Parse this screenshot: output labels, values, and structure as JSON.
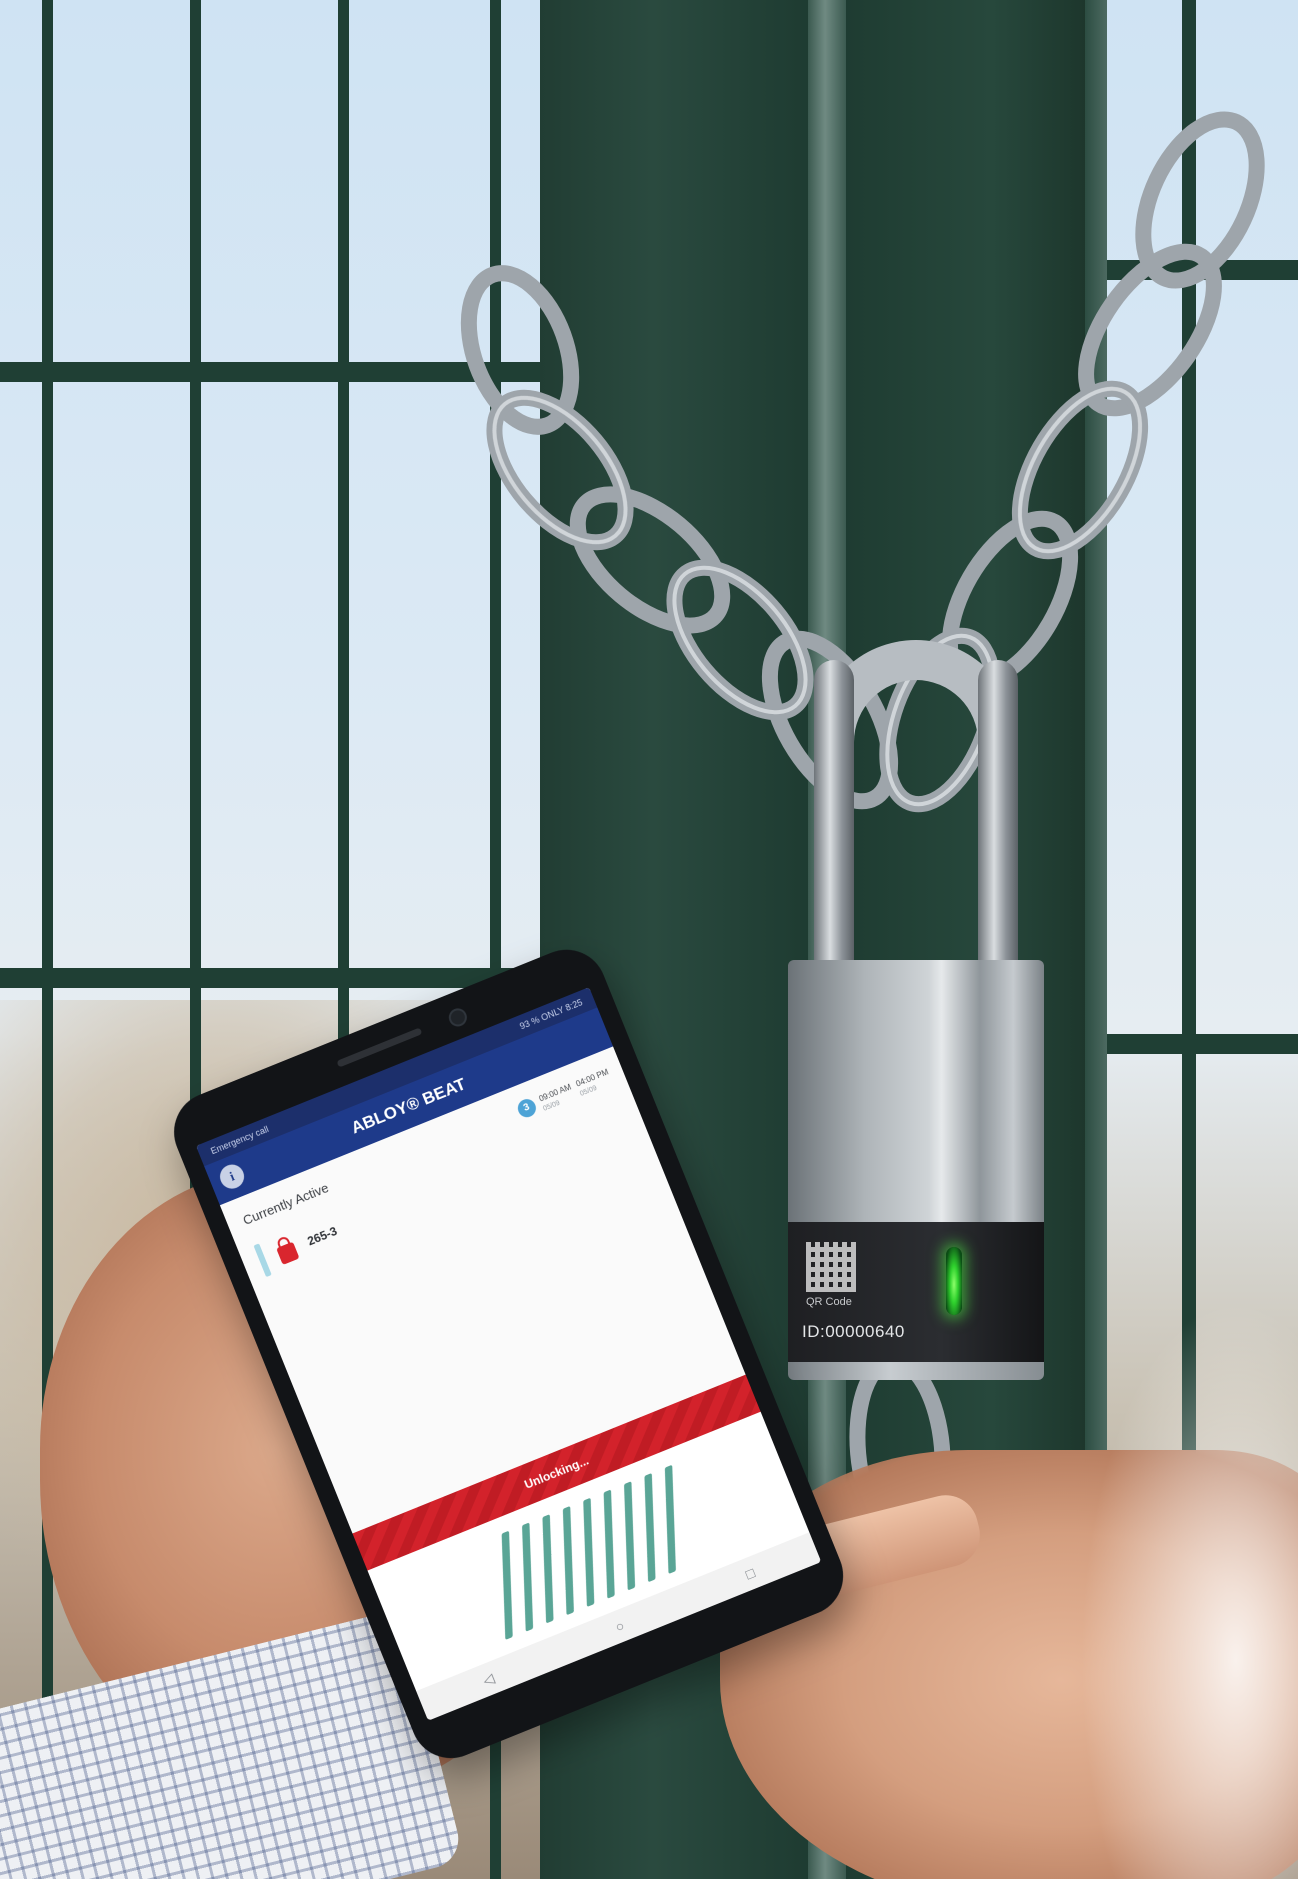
{
  "phone": {
    "status_left": "Emergency call",
    "status_right": "93 % ONLY 8:25",
    "app_title": "ABLOY® BEAT",
    "info_icon": "info-icon",
    "section_title": "Currently Active",
    "schedule": {
      "badge": "3",
      "start_time": "09:00 AM",
      "start_date": "05/09",
      "end_time": "04:00 PM",
      "end_date": "05/09"
    },
    "lock_item": {
      "name": "265-3",
      "icon": "padlock-icon"
    },
    "unlock_status": "Unlocking...",
    "progress_stripes": 9,
    "nav": {
      "back_icon": "back-triangle-icon",
      "home_icon": "home-circle-icon",
      "recents_icon": "recents-square-icon"
    }
  },
  "padlock": {
    "qr_label": "QR Code",
    "id_text": "ID:00000640",
    "led_state": "green"
  },
  "colors": {
    "app_bar": "#1e3a8a",
    "unlock_banner": "#d3222b",
    "progress_stripe": "#5aa596",
    "fence": "#1f3f34"
  }
}
